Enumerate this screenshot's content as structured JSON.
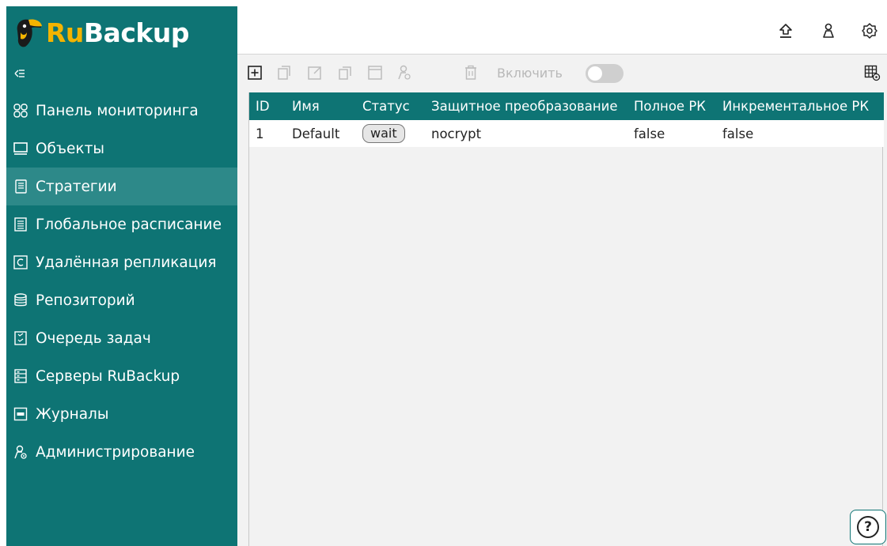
{
  "app": {
    "logo_prefix": "Ru",
    "logo_suffix": "Backup"
  },
  "sidebar": {
    "items": [
      {
        "label": "Панель мониторинга",
        "icon": "dashboard-icon"
      },
      {
        "label": "Объекты",
        "icon": "monitor-icon"
      },
      {
        "label": "Стратегии",
        "icon": "strategy-icon"
      },
      {
        "label": "Глобальное расписание",
        "icon": "schedule-icon"
      },
      {
        "label": "Удалённая репликация",
        "icon": "replication-icon"
      },
      {
        "label": "Репозиторий",
        "icon": "database-icon"
      },
      {
        "label": "Очередь задач",
        "icon": "task-queue-icon"
      },
      {
        "label": "Серверы RuBackup",
        "icon": "server-icon"
      },
      {
        "label": "Журналы",
        "icon": "log-icon"
      },
      {
        "label": "Администрирование",
        "icon": "admin-icon"
      }
    ],
    "active_index": 2
  },
  "toolbar": {
    "enable_label": "Включить",
    "enable_toggle_on": false
  },
  "table": {
    "columns": [
      "ID",
      "Имя",
      "Статус",
      "Защитное преобразование",
      "Полное РК",
      "Инкрементальное РК"
    ],
    "rows": [
      {
        "id": "1",
        "name": "Default",
        "status": "wait",
        "protection": "nocrypt",
        "full": "false",
        "incremental": "false"
      }
    ]
  },
  "help": {
    "label": "?"
  },
  "colors": {
    "primary": "#0e7474",
    "active": "#2d8989",
    "brand_yellow": "#f4b400",
    "toolbar_bg": "#f2f2f2"
  }
}
